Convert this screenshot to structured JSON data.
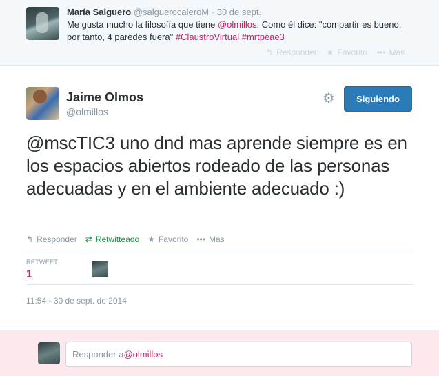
{
  "prev_tweet": {
    "name": "María Salguero",
    "handle": "@salguerocaleroM",
    "sep": "·",
    "date": "30 de sept.",
    "text_a": "Me gusta mucho la filosofía que tiene ",
    "mention": "@olmillos",
    "text_b": ". Como él dice: \"compartir es bueno, por tanto, 4 paredes fuera\" ",
    "hashtag1": "#ClaustroVirtual",
    "hashtag2": "#mrtpeae3",
    "actions": {
      "reply": "Responder",
      "favorite": "Favorito",
      "more": "Más"
    }
  },
  "tweet": {
    "name": "Jaime Olmos",
    "handle": "@olmillos",
    "follow_label": "Siguiendo",
    "text": "@mscTIC3 uno dnd mas aprende siempre es en los espacios abiertos rodeado de las personas adecuadas y en el ambiente adecuado :)",
    "actions": {
      "reply": "Responder",
      "retweeted": "Retwitteado",
      "favorite": "Favorito",
      "more": "Más"
    },
    "stats": {
      "retweet_label": "RETWEET",
      "retweet_count": "1"
    },
    "timestamp": "11:54 - 30 de sept. de 2014"
  },
  "reply": {
    "prefix": "Responder a ",
    "mention": "@olmillos"
  },
  "colors": {
    "accent": "#d0186b",
    "follow_button": "#2b7bb9",
    "retweet_green": "#19914a",
    "reply_bar": "#fde8ee"
  },
  "icons": [
    "reply-icon",
    "retweet-icon",
    "star-icon",
    "ellipsis-icon",
    "gear-icon"
  ]
}
